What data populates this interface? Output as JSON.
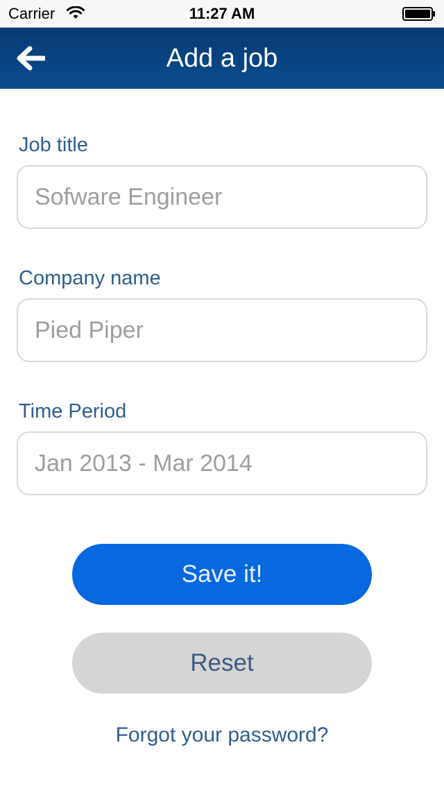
{
  "status_bar": {
    "carrier": "Carrier",
    "time": "11:27 AM",
    "icons": [
      "wifi-icon",
      "battery-icon"
    ]
  },
  "nav": {
    "title": "Add a job",
    "back_icon": "back-arrow-icon",
    "background_color": "#063a73"
  },
  "form": {
    "job_title": {
      "label": "Job title",
      "placeholder": "Sofware Engineer",
      "value": ""
    },
    "company_name": {
      "label": "Company name",
      "placeholder": "Pied Piper",
      "value": ""
    },
    "time_period": {
      "label": "Time Period",
      "placeholder": "Jan 2013 - Mar 2014",
      "value": ""
    }
  },
  "actions": {
    "save_label": "Save it!",
    "save_color": "#0768e0",
    "reset_label": "Reset",
    "reset_color": "#d5d5d5",
    "forgot_label": "Forgot your password?"
  }
}
